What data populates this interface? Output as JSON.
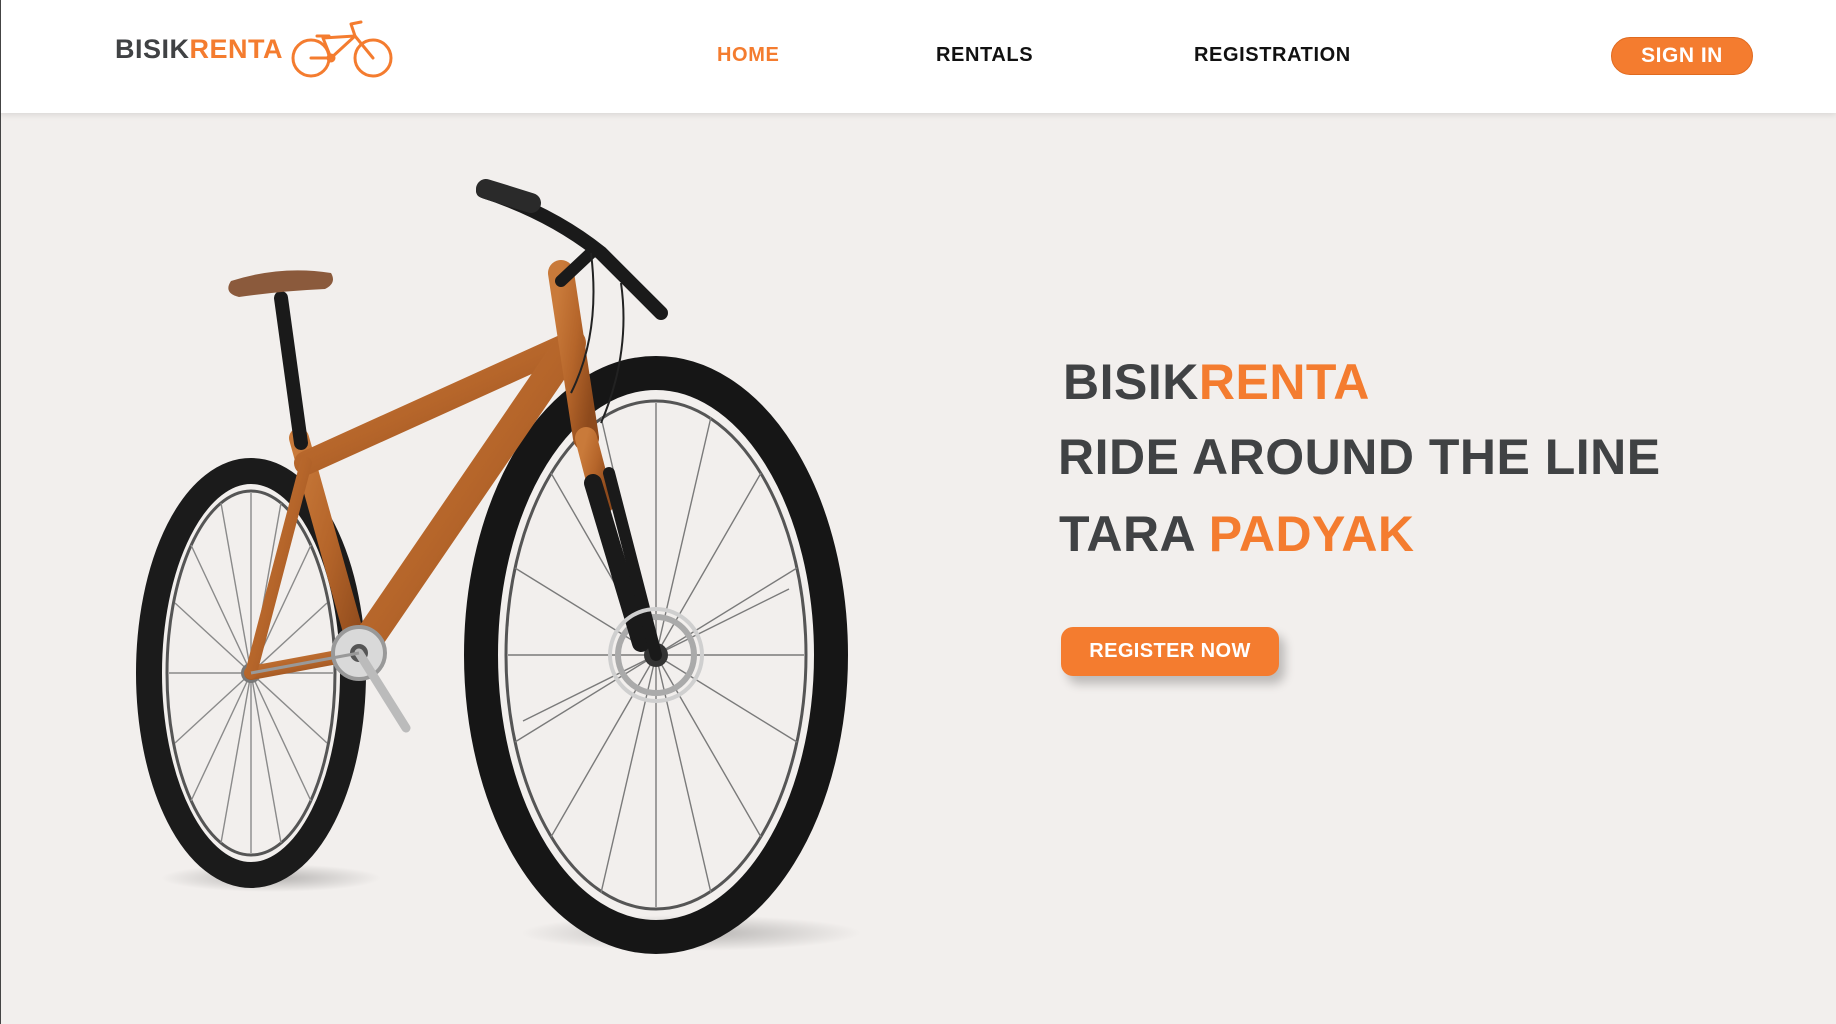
{
  "brand": {
    "part1": "BISIK",
    "part2": "RENTA"
  },
  "nav": {
    "home": "HOME",
    "rentals": "RENTALS",
    "registration": "REGISTRATION",
    "sign_in": "SIGN IN"
  },
  "hero": {
    "line1_a": "BISIK",
    "line1_b": "RENTA",
    "line2": "RIDE AROUND THE LINE",
    "line3_a": "TARA ",
    "line3_b": "PADYAK",
    "cta": "REGISTER NOW"
  },
  "colors": {
    "accent": "#f47c2f",
    "dark_text": "#404244",
    "background": "#f2efed",
    "bike_frame": "#b5652a"
  },
  "icons": {
    "logo": "bicycle-icon",
    "hero_image": "mountain-bike"
  }
}
